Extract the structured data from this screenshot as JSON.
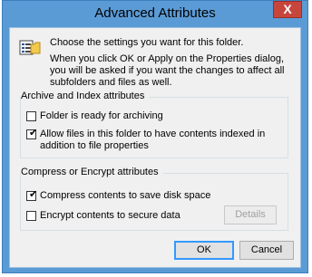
{
  "window": {
    "title": "Advanced Attributes",
    "close_glyph": "X"
  },
  "intro": {
    "line1": "Choose the settings you want for this folder.",
    "line2": "When you click OK or Apply on the Properties dialog, you will be asked if you want the changes to affect all subfolders and files as well."
  },
  "archive_group": {
    "title": "Archive and Index attributes",
    "items": [
      {
        "label": "Folder is ready for archiving",
        "checked": false
      },
      {
        "label": "Allow files in this folder to have contents indexed in addition to file properties",
        "checked": true
      }
    ]
  },
  "compress_group": {
    "title": "Compress or Encrypt attributes",
    "items": [
      {
        "label": "Compress contents to save disk space",
        "checked": true
      },
      {
        "label": "Encrypt contents to secure data",
        "checked": false
      }
    ],
    "details_label": "Details"
  },
  "buttons": {
    "ok_label": "OK",
    "cancel_label": "Cancel"
  },
  "check_glyph": "✔"
}
